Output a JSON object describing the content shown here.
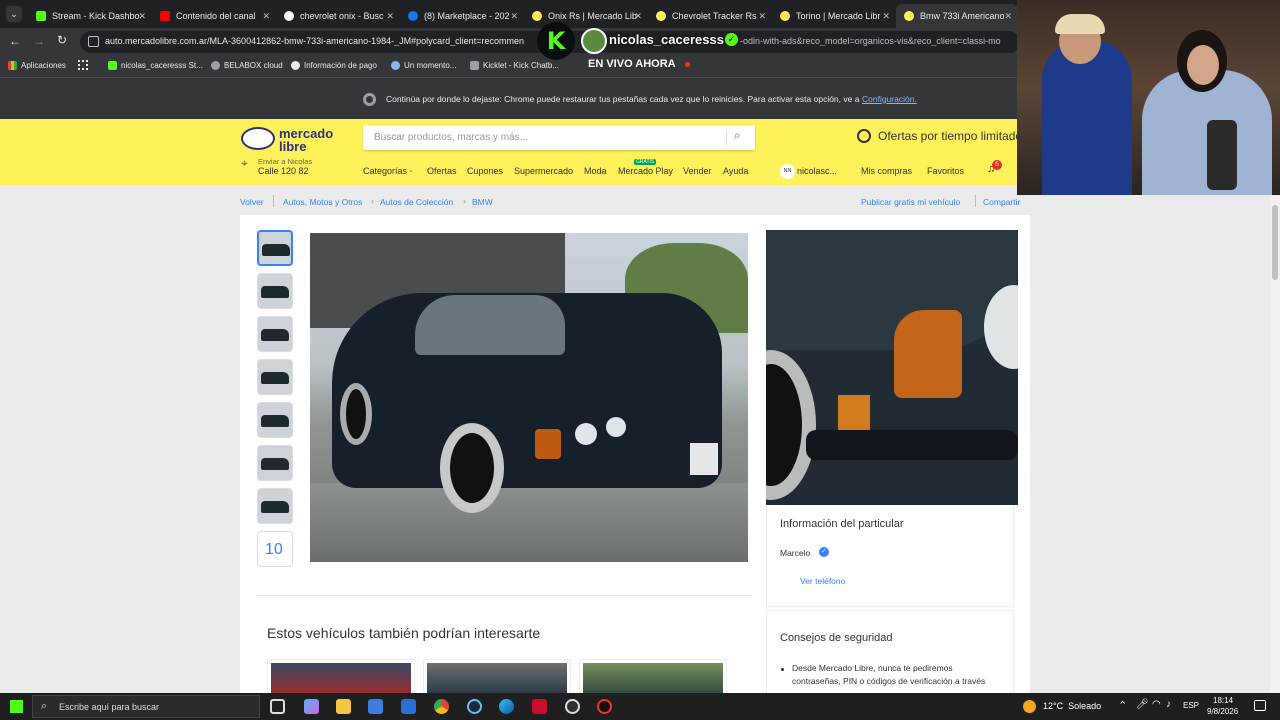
{
  "browser": {
    "tabs": [
      {
        "label": "Stream - Kick Dashbo",
        "icon_color": "#53fc18"
      },
      {
        "label": "Contenido del canal",
        "icon_color": "#ff0000"
      },
      {
        "label": "chevrolet onix - Busc",
        "icon_color": "#ffffff"
      },
      {
        "label": "(8) Marketplace - 202",
        "icon_color": "#1877f2"
      },
      {
        "label": "Onix Rs | Mercado Lib",
        "icon_color": "#fff159"
      },
      {
        "label": "Chevrolet Tracker Rs",
        "icon_color": "#fff159"
      },
      {
        "label": "Torino | Mercado Libr",
        "icon_color": "#fff159"
      },
      {
        "label": "Bmw 733i Americano",
        "icon_color": "#fff159"
      }
    ],
    "url": "auto.mercadolibre.com.ar/MLA-3600412862-bmw-733i-americano-1984-_JM#polycard_client=recommen",
    "url_tail": "-odin-with-ads&reco_model=organicos-vis&reco_client=classi-mo",
    "bookmarks": [
      "Aplicaciones",
      "nicolas_caceresss St...",
      "BELABOX cloud",
      "Información de pago",
      "Un momento...",
      "Kicklet - Kick Chatb..."
    ],
    "infobar_text": "Continúa por donde lo dejaste: Chrome puede restaurar tus pestañas cada vez que lo reinicies. Para activar esta opción, ve a",
    "infobar_link": "Configuración."
  },
  "stream_overlay": {
    "username": "nicolas_caceresss",
    "live_label": "EN VIVO AHORA"
  },
  "ml": {
    "logo_line1": "mercado",
    "logo_line2": "libre",
    "search_placeholder": "Buscar productos, marcas y más...",
    "promo": "Ofertas por tiempo limitado",
    "ship_label": "Enviar a Nicolas",
    "ship_address": "Calle 120 82",
    "nav": [
      "Categorías",
      "Ofertas",
      "Cupones",
      "Supermercado",
      "Moda",
      "Mercado Play",
      "Vender",
      "Ayuda"
    ],
    "nav_badge": "GRATIS",
    "user_initials": "NN",
    "user_name": "nicolasc...",
    "my_purchases": "Mis compras",
    "favorites": "Favoritos",
    "notif_count": "5"
  },
  "page": {
    "back": "Volver",
    "breadcrumb": [
      "Autos, Motos y Otros",
      "Autos de Colección",
      "BMW"
    ],
    "publish_link": "Publicar gratis mi vehículo",
    "share": "Compartir",
    "more_photos": "10",
    "seller_section_title": "Información del particular",
    "seller_name": "Marcelo",
    "phone_link": "Ver teléfono",
    "related_title": "Estos vehículos también podrían interesarte",
    "safety_title": "Consejos de seguridad",
    "safety_text_1": "Desde Mercado Libre, nunca te pediremos",
    "safety_text_2": "contraseñas, PIN o códigos de verificación a través"
  },
  "taskbar": {
    "search_text": "Escribe aquí para buscar",
    "weather": "12°C  Soleado",
    "lang": "ESP",
    "time": "18:14",
    "date": "9/8/2026"
  },
  "colors": {
    "ml_yellow": "#fff159",
    "ml_blue": "#3483fa",
    "chrome_dark": "#35363a"
  }
}
